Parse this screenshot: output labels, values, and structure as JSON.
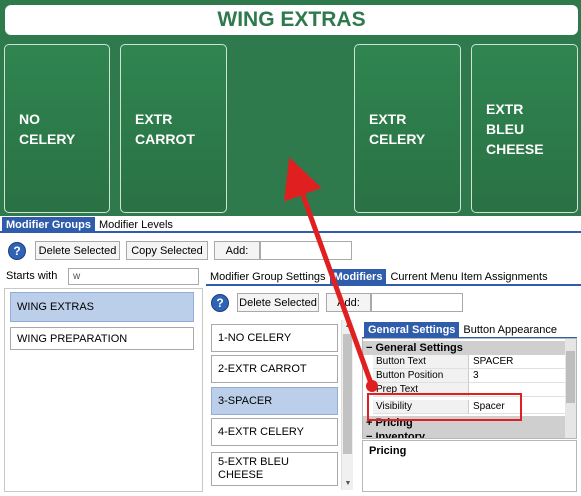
{
  "preview": {
    "title": "WING EXTRAS",
    "tiles": [
      "NO CELERY",
      "EXTR CARROT",
      "EXTR CELERY",
      "EXTR BLEU\nCHEESE"
    ]
  },
  "modifier_tabs": [
    "Modifier Groups",
    "Modifier Levels"
  ],
  "toolbar": {
    "delete_selected": "Delete Selected",
    "copy_selected": "Copy Selected",
    "add_label": "Add:",
    "add_value": ""
  },
  "filter": {
    "label": "Starts with",
    "value": "w"
  },
  "groups": [
    "WING EXTRAS",
    "WING PREPARATION"
  ],
  "detail_tabs": [
    "Modifier Group Settings",
    "Modifiers",
    "Current Menu Item Assignments"
  ],
  "modifiers_toolbar": {
    "delete_selected": "Delete Selected",
    "add_label": "Add:",
    "add_value": ""
  },
  "modifiers": [
    "1-NO CELERY",
    "2-EXTR CARROT",
    "3-SPACER",
    "4-EXTR CELERY",
    "5-EXTR BLEU CHEESE"
  ],
  "property_tabs": [
    "General Settings",
    "Button Appearance"
  ],
  "property_grid": {
    "category_general": "General Settings",
    "rows": [
      {
        "key": "Button Text",
        "value": "SPACER"
      },
      {
        "key": "Button Position",
        "value": "3"
      },
      {
        "key": "Prep Text",
        "value": ""
      },
      {
        "key": "Visibility",
        "value": "Spacer"
      }
    ],
    "category_pricing": "Pricing",
    "category_inventory": "Inventory"
  },
  "description_panel": {
    "title": "Pricing"
  },
  "colors": {
    "preview_green": "#2e7a4c",
    "tab_blue": "#2f5cab",
    "selection": "#bccfea",
    "annotation_red": "#e02020"
  }
}
